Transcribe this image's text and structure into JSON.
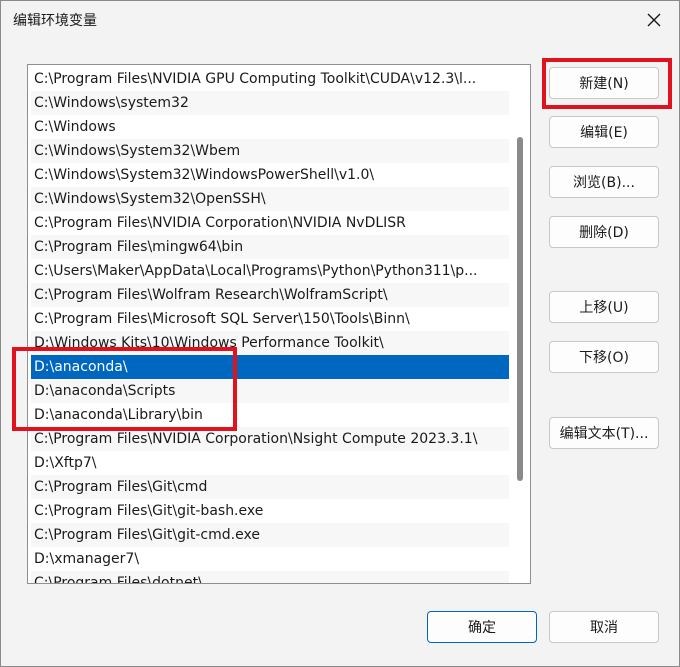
{
  "window": {
    "title": "编辑环境变量"
  },
  "list": {
    "items": [
      "C:\\Program Files\\NVIDIA GPU Computing Toolkit\\CUDA\\v12.3\\l...",
      "C:\\Windows\\system32",
      "C:\\Windows",
      "C:\\Windows\\System32\\Wbem",
      "C:\\Windows\\System32\\WindowsPowerShell\\v1.0\\",
      "C:\\Windows\\System32\\OpenSSH\\",
      "C:\\Program Files\\NVIDIA Corporation\\NVIDIA NvDLISR",
      "C:\\Program Files\\mingw64\\bin",
      "C:\\Users\\Maker\\AppData\\Local\\Programs\\Python\\Python311\\p...",
      "C:\\Program Files\\Wolfram Research\\WolframScript\\",
      "C:\\Program Files\\Microsoft SQL Server\\150\\Tools\\Binn\\",
      "D:\\Windows Kits\\10\\Windows Performance Toolkit\\",
      "D:\\anaconda\\",
      "D:\\anaconda\\Scripts",
      "D:\\anaconda\\Library\\bin",
      "C:\\Program Files\\NVIDIA Corporation\\Nsight Compute 2023.3.1\\",
      "D:\\Xftp7\\",
      "C:\\Program Files\\Git\\cmd",
      "C:\\Program Files\\Git\\git-bash.exe",
      "C:\\Program Files\\Git\\git-cmd.exe",
      "D:\\xmanager7\\",
      "C:\\Program Files\\dotnet\\"
    ],
    "selected_index": 12
  },
  "buttons": {
    "new": "新建(N)",
    "edit": "编辑(E)",
    "browse": "浏览(B)...",
    "delete": "删除(D)",
    "move_up": "上移(U)",
    "move_down": "下移(O)",
    "edit_text": "编辑文本(T)...",
    "ok": "确定",
    "cancel": "取消"
  },
  "colors": {
    "selection": "#0067c0",
    "highlight_box": "#e0121d"
  },
  "icons": {
    "close": "close-icon"
  }
}
